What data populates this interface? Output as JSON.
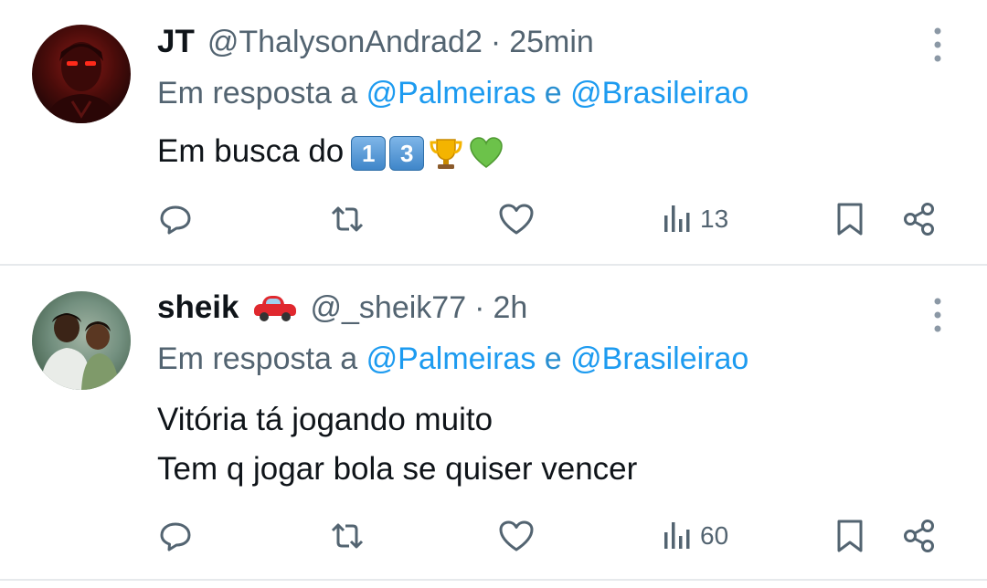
{
  "colors": {
    "text": "#0f1419",
    "secondary": "#536471",
    "link": "#1d9bf0",
    "divider": "#e6e9ec",
    "heart_emoji": "#6cc24a"
  },
  "tweets": [
    {
      "display_name": "JT",
      "name_emoji": "",
      "handle": "@ThalysonAndrad2",
      "separator": "·",
      "time": "25min",
      "reply_prefix": "Em resposta a",
      "mention_1": "@Palmeiras",
      "reply_join": "e",
      "mention_2": "@Brasileirao",
      "text_line_1": "Em busca do",
      "emojis": [
        "keycap-1",
        "keycap-3",
        "trophy-icon",
        "green-heart-icon"
      ],
      "keycap_1": "1",
      "keycap_2": "3",
      "views": "13",
      "icons": [
        "reply-icon",
        "retweet-icon",
        "like-icon",
        "views-icon",
        "bookmark-icon",
        "share-icon",
        "more-icon"
      ]
    },
    {
      "display_name": "sheik",
      "name_emoji": "car-icon",
      "handle": "@_sheik77",
      "separator": "·",
      "time": "2h",
      "reply_prefix": "Em resposta a",
      "mention_1": "@Palmeiras",
      "reply_join": "e",
      "mention_2": "@Brasileirao",
      "text_line_1": "Vitória tá jogando muito",
      "text_line_2": "Tem q jogar bola se quiser vencer",
      "views": "60",
      "icons": [
        "reply-icon",
        "retweet-icon",
        "like-icon",
        "views-icon",
        "bookmark-icon",
        "share-icon",
        "more-icon"
      ]
    }
  ]
}
